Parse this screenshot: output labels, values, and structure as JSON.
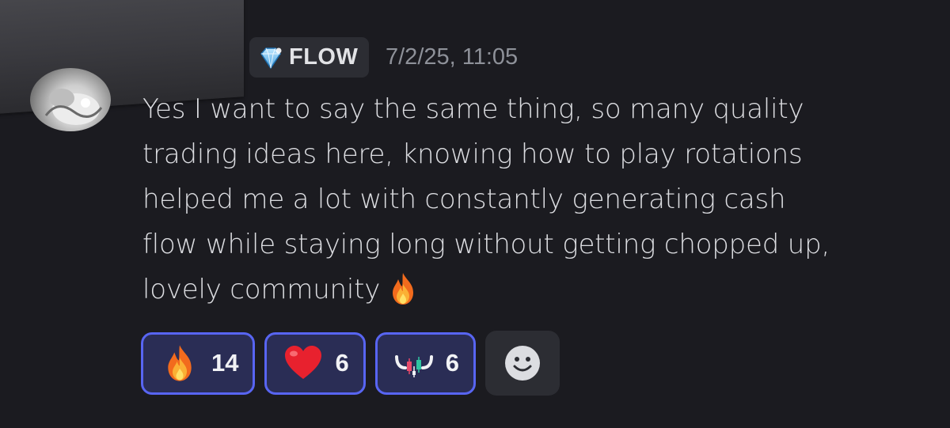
{
  "message": {
    "author_tag": {
      "icon": "diamond-badge-icon",
      "label": "FLOW"
    },
    "timestamp": "7/2/25, 11:05",
    "lines": [
      "Yes I want to say the same thing, so many quality",
      "trading ideas here, knowing how to play rotations",
      "helped me a lot with constantly generating cash",
      "flow while staying long without getting chopped up,",
      "lovely community"
    ],
    "trailing_emoji": "fire-emoji"
  },
  "reactions": [
    {
      "emoji": "fire-emoji",
      "count": "14",
      "active": true
    },
    {
      "emoji": "red-heart-emoji",
      "count": "6",
      "active": true
    },
    {
      "emoji": "bull-candles-emoji",
      "count": "6",
      "active": true
    }
  ],
  "add_reaction": {
    "icon": "smiley-face-icon"
  },
  "colors": {
    "background": "#1b1b20",
    "reaction_border": "#5865f2",
    "reaction_bg": "#2a2d55",
    "tag_bg": "#2c2d33",
    "text": "#dcdde1",
    "timestamp": "#8e9199"
  }
}
